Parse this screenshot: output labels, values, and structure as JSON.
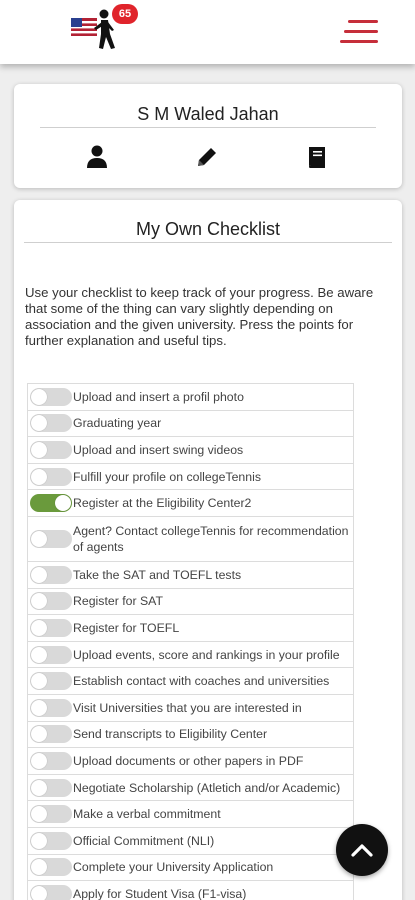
{
  "header": {
    "notification_count": "65",
    "logo_icon": "tennis-player-logo-icon",
    "menu_icon": "hamburger-menu-icon"
  },
  "profile": {
    "name": "S M Waled Jahan",
    "icons": [
      "person-icon",
      "pencil-icon",
      "book-icon"
    ]
  },
  "checklist": {
    "title": "My Own Checklist",
    "intro": "Use your checklist to keep track of your progress. Be aware that some of the thing can vary slightly depending on association and the given university. Press the points for further explanation and useful tips.",
    "items": [
      {
        "label": "Upload and insert a profil photo",
        "checked": false
      },
      {
        "label": "Graduating year",
        "checked": false
      },
      {
        "label": "Upload and insert swing videos",
        "checked": false
      },
      {
        "label": "Fulfill your profile on collegeTennis",
        "checked": false
      },
      {
        "label": "Register at the Eligibility Center2",
        "checked": true
      },
      {
        "label": "Agent? Contact collegeTennis for recommendation of agents",
        "checked": false
      },
      {
        "label": "Take the SAT and TOEFL tests",
        "checked": false
      },
      {
        "label": "Register for SAT",
        "checked": false
      },
      {
        "label": "Register for TOEFL",
        "checked": false
      },
      {
        "label": "Upload events, score and rankings in your profile",
        "checked": false
      },
      {
        "label": "Establish contact with coaches and universities",
        "checked": false
      },
      {
        "label": "Visit Universities that you are interested in",
        "checked": false
      },
      {
        "label": "Send transcripts to Eligibility Center",
        "checked": false
      },
      {
        "label": "Upload documents or other papers in PDF",
        "checked": false
      },
      {
        "label": "Negotiate Scholarship (Atletich and/or Academic)",
        "checked": false
      },
      {
        "label": "Make a verbal commitment",
        "checked": false
      },
      {
        "label": "Official Commitment (NLI)",
        "checked": false
      },
      {
        "label": "Complete your University Application",
        "checked": false
      },
      {
        "label": "Apply for Student Visa (F1-visa)",
        "checked": false
      }
    ]
  },
  "colors": {
    "accent": "#c62e3a",
    "toggle_on": "#6a9a3c",
    "toggle_off": "#d9d9d9",
    "badge": "#e0242b"
  },
  "fab": {
    "icon": "chevron-up-icon"
  }
}
